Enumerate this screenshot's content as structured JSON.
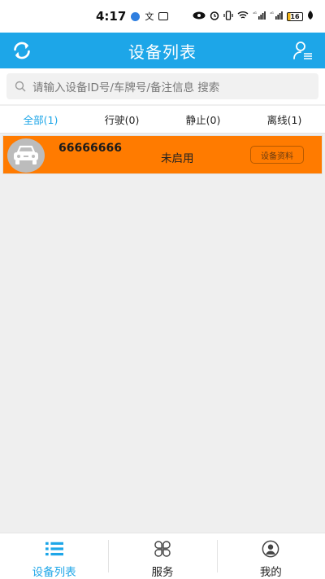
{
  "status_bar": {
    "time": "4:17",
    "battery_level": "16",
    "signal_labels": [
      "⁴ᴳ",
      "⁴ᴳ"
    ]
  },
  "header": {
    "title": "设备列表",
    "left_icon": "refresh-icon",
    "right_icon": "user-list-icon",
    "color": "#1da6e8"
  },
  "search": {
    "placeholder": "请输入设备ID号/车牌号/备注信息 搜索"
  },
  "tabs": [
    {
      "label": "全部(1)",
      "active": true
    },
    {
      "label": "行驶(0)",
      "active": false
    },
    {
      "label": "静止(0)",
      "active": false
    },
    {
      "label": "离线(1)",
      "active": false
    }
  ],
  "devices": [
    {
      "id": "66666666",
      "status": "未启用",
      "button_label": "设备资料",
      "row_color": "#ff7b00",
      "avatar_icon": "car-icon"
    }
  ],
  "bottom_nav": [
    {
      "label": "设备列表",
      "icon": "list-icon",
      "active": true
    },
    {
      "label": "服务",
      "icon": "clover-grid-icon",
      "active": false
    },
    {
      "label": "我的",
      "icon": "profile-circle-icon",
      "active": false
    }
  ]
}
